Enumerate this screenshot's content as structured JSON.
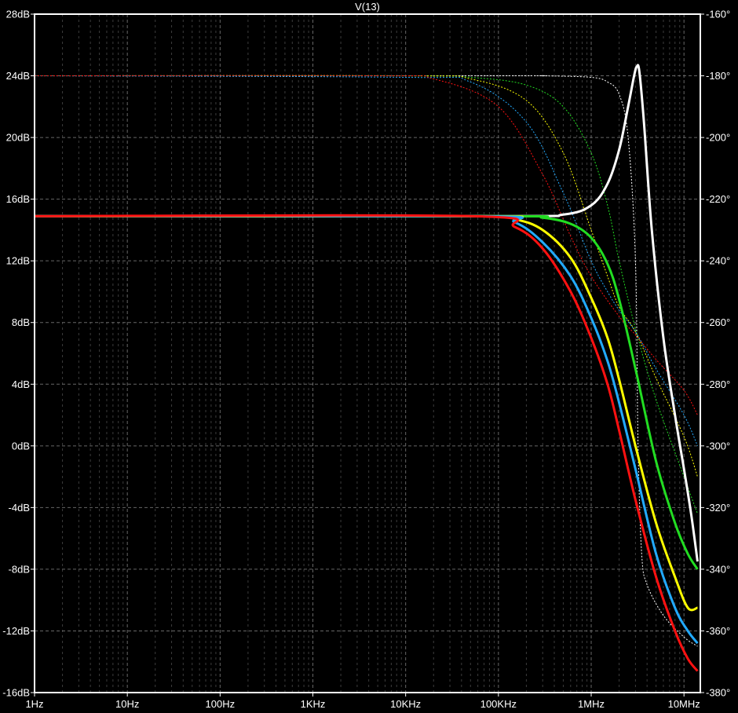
{
  "chart_data": {
    "type": "line",
    "title": "V(13)",
    "x_scale": "log",
    "xlim": [
      1,
      15000000
    ],
    "x_ticks": [
      {
        "value": 1,
        "label": "1Hz"
      },
      {
        "value": 10,
        "label": "10Hz"
      },
      {
        "value": 100,
        "label": "100Hz"
      },
      {
        "value": 1000,
        "label": "1KHz"
      },
      {
        "value": 10000,
        "label": "10KHz"
      },
      {
        "value": 100000,
        "label": "100KHz"
      },
      {
        "value": 1000000,
        "label": "1MHz"
      },
      {
        "value": 10000000,
        "label": "10MHz"
      }
    ],
    "ylim_left": [
      -16,
      28
    ],
    "y_ticks_left": [
      {
        "value": 28,
        "label": "28dB"
      },
      {
        "value": 24,
        "label": "24dB"
      },
      {
        "value": 20,
        "label": "20dB"
      },
      {
        "value": 16,
        "label": "16dB"
      },
      {
        "value": 12,
        "label": "12dB"
      },
      {
        "value": 8,
        "label": "8dB"
      },
      {
        "value": 4,
        "label": "4dB"
      },
      {
        "value": 0,
        "label": "0dB"
      },
      {
        "value": -4,
        "label": "-4dB"
      },
      {
        "value": -8,
        "label": "-8dB"
      },
      {
        "value": -12,
        "label": "-12dB"
      },
      {
        "value": -16,
        "label": "-16dB"
      }
    ],
    "ylim_right": [
      -380,
      -160
    ],
    "y_ticks_right": [
      {
        "value": -160,
        "label": "-160°"
      },
      {
        "value": -180,
        "label": "-180°"
      },
      {
        "value": -200,
        "label": "-200°"
      },
      {
        "value": -220,
        "label": "-220°"
      },
      {
        "value": -240,
        "label": "-240°"
      },
      {
        "value": -260,
        "label": "-260°"
      },
      {
        "value": -280,
        "label": "-280°"
      },
      {
        "value": -300,
        "label": "-300°"
      },
      {
        "value": -320,
        "label": "-320°"
      },
      {
        "value": -340,
        "label": "-340°"
      },
      {
        "value": -360,
        "label": "-360°"
      },
      {
        "value": -380,
        "label": "-380°"
      }
    ],
    "grid": true,
    "colors": {
      "background": "#000000",
      "frame": "#ffffff",
      "grid": "#666666",
      "text": "#ffffff"
    },
    "magnitude_series": [
      {
        "color": "#ffffff",
        "points": [
          [
            1,
            14.9
          ],
          [
            100000,
            14.9
          ],
          [
            500000,
            15.0
          ],
          [
            1000000,
            15.6
          ],
          [
            1500000,
            17.0
          ],
          [
            2000000,
            19.2
          ],
          [
            2500000,
            22.0
          ],
          [
            2900000,
            24.0
          ],
          [
            3100000,
            24.6
          ],
          [
            3300000,
            24.3
          ],
          [
            3700000,
            21.0
          ],
          [
            4500000,
            14.0
          ],
          [
            6000000,
            7.0
          ],
          [
            8000000,
            2.0
          ],
          [
            10000000,
            -1.5
          ],
          [
            12000000,
            -4.5
          ],
          [
            14000000,
            -7.5
          ]
        ]
      },
      {
        "color": "#22dd22",
        "points": [
          [
            1,
            14.9
          ],
          [
            100000,
            14.9
          ],
          [
            300000,
            14.8
          ],
          [
            600000,
            14.4
          ],
          [
            1000000,
            13.5
          ],
          [
            1500000,
            11.8
          ],
          [
            2000000,
            9.5
          ],
          [
            3000000,
            5.0
          ],
          [
            5000000,
            -1.0
          ],
          [
            8000000,
            -5.0
          ],
          [
            11000000,
            -7.0
          ],
          [
            14000000,
            -8.0
          ]
        ]
      },
      {
        "color": "#ffff00",
        "points": [
          [
            1,
            14.9
          ],
          [
            60000,
            14.9
          ],
          [
            150000,
            14.7
          ],
          [
            300000,
            14.0
          ],
          [
            600000,
            12.2
          ],
          [
            1000000,
            9.6
          ],
          [
            1500000,
            7.0
          ],
          [
            2000000,
            4.3
          ],
          [
            3000000,
            0.0
          ],
          [
            5000000,
            -5.0
          ],
          [
            8000000,
            -8.5
          ],
          [
            11000000,
            -10.5
          ],
          [
            14000000,
            -10.5
          ]
        ]
      },
      {
        "color": "#22aaff",
        "points": [
          [
            1,
            14.9
          ],
          [
            60000,
            14.9
          ],
          [
            150000,
            14.5
          ],
          [
            300000,
            13.2
          ],
          [
            600000,
            11.0
          ],
          [
            1000000,
            8.3
          ],
          [
            1500000,
            5.5
          ],
          [
            2000000,
            2.8
          ],
          [
            3000000,
            -1.5
          ],
          [
            5000000,
            -7.0
          ],
          [
            8000000,
            -10.5
          ],
          [
            11000000,
            -12.0
          ],
          [
            14000000,
            -12.8
          ]
        ]
      },
      {
        "color": "#ff1111",
        "points": [
          [
            1,
            14.9
          ],
          [
            50000,
            14.9
          ],
          [
            150000,
            14.2
          ],
          [
            300000,
            12.8
          ],
          [
            600000,
            10.0
          ],
          [
            1000000,
            7.0
          ],
          [
            1500000,
            4.0
          ],
          [
            2000000,
            1.0
          ],
          [
            3000000,
            -3.5
          ],
          [
            5000000,
            -8.5
          ],
          [
            8000000,
            -12.0
          ],
          [
            11000000,
            -13.8
          ],
          [
            14000000,
            -14.6
          ]
        ]
      }
    ],
    "phase_series": [
      {
        "color": "#ffffff",
        "points": [
          [
            1,
            -180
          ],
          [
            100000,
            -180
          ],
          [
            300000,
            -180
          ],
          [
            1000000,
            -180.5
          ],
          [
            1500000,
            -182
          ],
          [
            2000000,
            -186
          ],
          [
            2500000,
            -200
          ],
          [
            3000000,
            -240
          ],
          [
            3200000,
            -300
          ],
          [
            3500000,
            -335
          ],
          [
            4000000,
            -345
          ],
          [
            6000000,
            -355
          ],
          [
            10000000,
            -362
          ],
          [
            14000000,
            -365
          ]
        ]
      },
      {
        "color": "#22dd22",
        "points": [
          [
            1,
            -180
          ],
          [
            10000,
            -180
          ],
          [
            50000,
            -180.5
          ],
          [
            200000,
            -183
          ],
          [
            500000,
            -190
          ],
          [
            1000000,
            -205
          ],
          [
            1500000,
            -222
          ],
          [
            2000000,
            -240
          ],
          [
            3000000,
            -262
          ],
          [
            5000000,
            -285
          ],
          [
            10000000,
            -310
          ],
          [
            14000000,
            -322
          ]
        ]
      },
      {
        "color": "#ffff00",
        "points": [
          [
            1,
            -180
          ],
          [
            10000,
            -180
          ],
          [
            50000,
            -181
          ],
          [
            200000,
            -188
          ],
          [
            500000,
            -205
          ],
          [
            1000000,
            -230
          ],
          [
            1500000,
            -245
          ],
          [
            2000000,
            -255
          ],
          [
            3000000,
            -263
          ],
          [
            5000000,
            -278
          ],
          [
            10000000,
            -297
          ],
          [
            14000000,
            -310
          ]
        ]
      },
      {
        "color": "#22aaff",
        "points": [
          [
            1,
            -180
          ],
          [
            10000,
            -180.5
          ],
          [
            50000,
            -182
          ],
          [
            200000,
            -195
          ],
          [
            500000,
            -218
          ],
          [
            1000000,
            -240
          ],
          [
            1500000,
            -250
          ],
          [
            2000000,
            -256
          ],
          [
            3000000,
            -263
          ],
          [
            5000000,
            -275
          ],
          [
            10000000,
            -290
          ],
          [
            14000000,
            -300
          ]
        ]
      },
      {
        "color": "#ff1111",
        "points": [
          [
            1,
            -180
          ],
          [
            5000,
            -180
          ],
          [
            20000,
            -181
          ],
          [
            100000,
            -190
          ],
          [
            300000,
            -212
          ],
          [
            600000,
            -232
          ],
          [
            1000000,
            -245
          ],
          [
            2000000,
            -258
          ],
          [
            3000000,
            -264
          ],
          [
            5000000,
            -272
          ],
          [
            10000000,
            -282
          ],
          [
            14000000,
            -290
          ]
        ]
      }
    ]
  }
}
